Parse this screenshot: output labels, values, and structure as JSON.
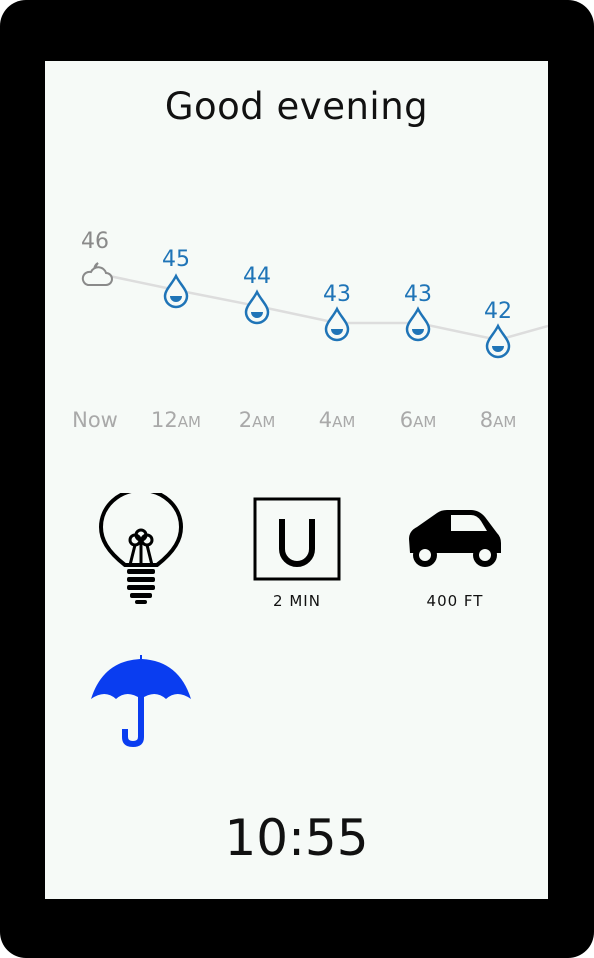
{
  "greeting": "Good evening",
  "forecast": {
    "current": {
      "temp": "46",
      "icon": "partly-cloudy-night-icon"
    },
    "hours": [
      {
        "time": "Now",
        "suffix": "",
        "temp": "46",
        "icon": "partly-cloudy-night-icon"
      },
      {
        "time": "12",
        "suffix": "AM",
        "temp": "45",
        "icon": "raindrop-icon"
      },
      {
        "time": "2",
        "suffix": "AM",
        "temp": "44",
        "icon": "raindrop-icon"
      },
      {
        "time": "4",
        "suffix": "AM",
        "temp": "43",
        "icon": "raindrop-icon"
      },
      {
        "time": "6",
        "suffix": "AM",
        "temp": "43",
        "icon": "raindrop-icon"
      },
      {
        "time": "8",
        "suffix": "AM",
        "temp": "42",
        "icon": "raindrop-icon"
      }
    ],
    "colors": {
      "rain": "#1f74b7",
      "now": "#8a8a8a",
      "line": "#dddddd"
    }
  },
  "tiles": {
    "lightbulb": {
      "icon": "lightbulb-icon"
    },
    "uber": {
      "icon": "uber-logo-icon",
      "label": "2 MIN"
    },
    "car": {
      "icon": "car-icon",
      "label": "400 FT"
    },
    "umbrella": {
      "icon": "umbrella-icon",
      "color": "#0a3df0"
    }
  },
  "clock": "10:55"
}
